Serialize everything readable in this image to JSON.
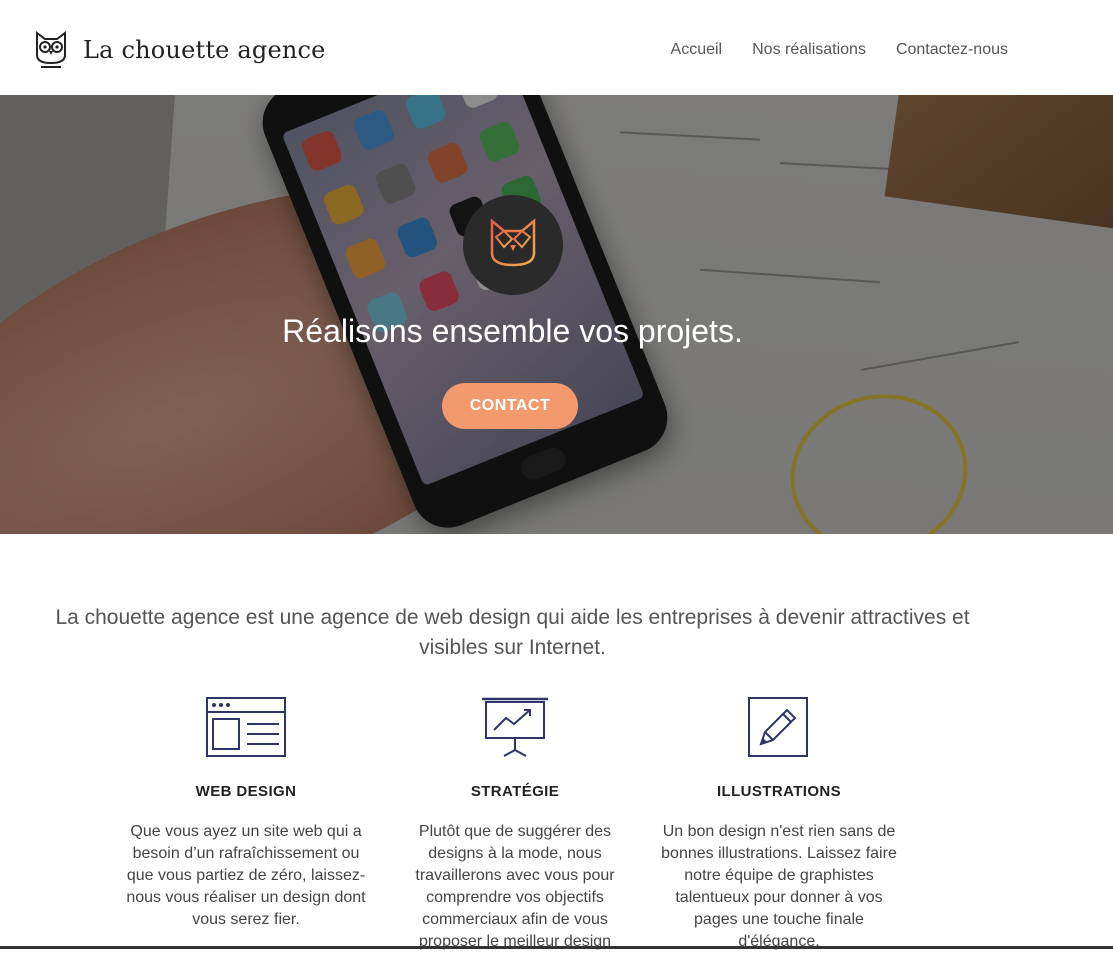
{
  "header": {
    "brand": "La chouette agence",
    "nav": [
      {
        "label": "Accueil"
      },
      {
        "label": "Nos réalisations"
      },
      {
        "label": "Contactez-nous"
      }
    ]
  },
  "hero": {
    "title": "Réalisons ensemble vos projets.",
    "cta_label": "CONTACT"
  },
  "intro": {
    "text": "La chouette agence est une agence de web design qui aide les entreprises à devenir attractives et visibles sur Internet."
  },
  "services": [
    {
      "icon": "browser-window-icon",
      "title": "WEB DESIGN",
      "description": "Que vous ayez un site web qui a besoin d’un rafraîchissement ou que vous partiez de zéro, laissez-nous vous réaliser un design dont vous serez fier."
    },
    {
      "icon": "presentation-chart-icon",
      "title": "STRATÉGIE",
      "description": "Plutôt que de suggérer des designs à la mode, nous travaillerons avec vous pour comprendre vos objectifs commerciaux afin de vous proposer le meilleur design"
    },
    {
      "icon": "pencil-icon",
      "title": "ILLUSTRATIONS",
      "description": "Un bon design n'est rien sans de bonnes illustrations. Laissez faire notre équipe de graphistes talentueux pour donner à vos pages une touche finale d'élégance."
    }
  ],
  "colors": {
    "accent": "#f29a6e",
    "icon_stroke": "#2e3566",
    "text": "#555555"
  }
}
